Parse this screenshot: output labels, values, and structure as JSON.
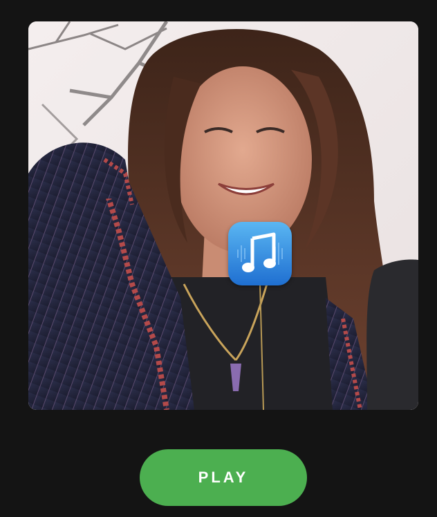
{
  "play_button": {
    "label": "PLAY"
  },
  "artwork": {
    "icon": "music-note-icon"
  },
  "colors": {
    "background": "#141414",
    "play_button": "#4caf50",
    "badge_top": "#5ab6f2",
    "badge_bottom": "#1f6fd1"
  }
}
